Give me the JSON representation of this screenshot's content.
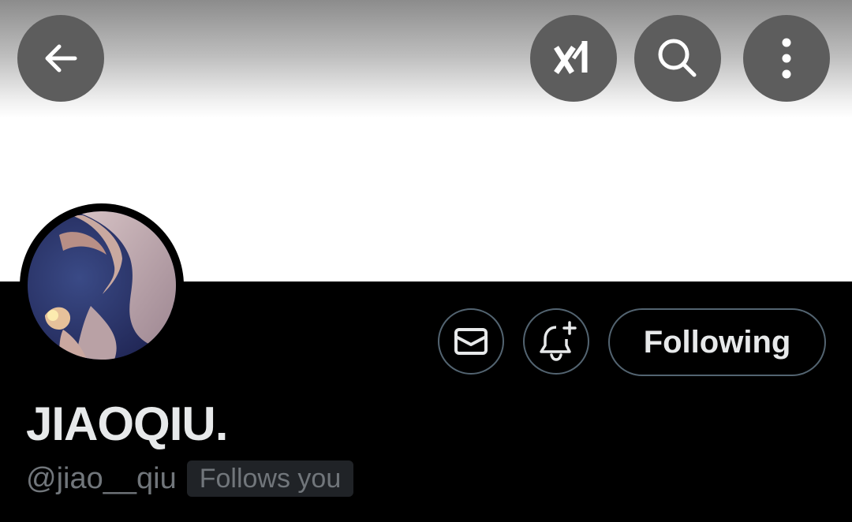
{
  "header": {
    "back_icon": "arrow-left-icon",
    "grok_icon": "grok-icon",
    "search_icon": "search-icon",
    "more_icon": "more-vertical-icon"
  },
  "profile": {
    "display_name": "JIAOQIU.",
    "handle": "@jiao__qiu",
    "follows_you_label": "Follows you",
    "following_label": "Following",
    "avatar_icon": "avatar"
  },
  "actions": {
    "message_icon": "envelope-icon",
    "notify_icon": "bell-plus-icon"
  },
  "colors": {
    "background": "#000000",
    "text_primary": "#e7e9ea",
    "text_secondary": "#71767b",
    "button_border": "#536471",
    "header_button_bg": "#5d5d5d",
    "badge_bg": "#202327"
  }
}
